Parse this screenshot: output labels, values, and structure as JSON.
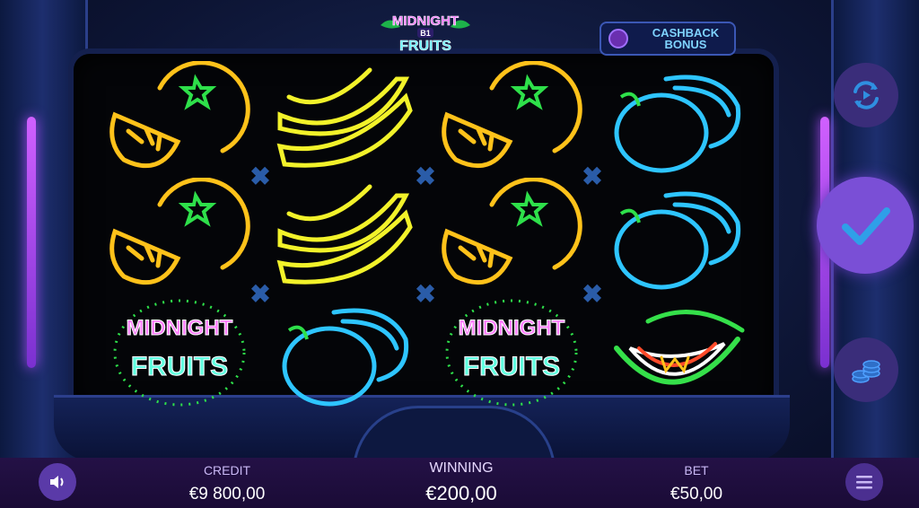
{
  "game": {
    "logo_line1": "MIDNIGHT",
    "logo_badge": "B1",
    "logo_line2": "FRUITS",
    "cashback_label_1": "CASHBACK",
    "cashback_label_2": "BONUS"
  },
  "reels": [
    [
      "orange",
      "orange",
      "midnight-fruits-logo"
    ],
    [
      "banana",
      "banana",
      "plum"
    ],
    [
      "orange",
      "orange",
      "midnight-fruits-logo"
    ],
    [
      "plum",
      "plum",
      "watermelon"
    ]
  ],
  "symbol_text": {
    "logo_top": "MIDNIGHT",
    "logo_bottom": "FRUITS"
  },
  "footer": {
    "credit_label": "CREDIT",
    "credit_value": "€9 800,00",
    "winning_label": "WINNING",
    "winning_value": "€200,00",
    "bet_label": "BET",
    "bet_value": "€50,00"
  },
  "colors": {
    "orange_neon": "#ffc21a",
    "banana_neon": "#f2f22a",
    "plum_neon": "#2ec5ff",
    "melon_neon": "#35e04a",
    "accent_purple": "#7a4fd6"
  },
  "icons": [
    "autoplay-icon",
    "spin-check-icon",
    "coins-icon",
    "sound-icon",
    "menu-icon",
    "multiply-icon"
  ]
}
